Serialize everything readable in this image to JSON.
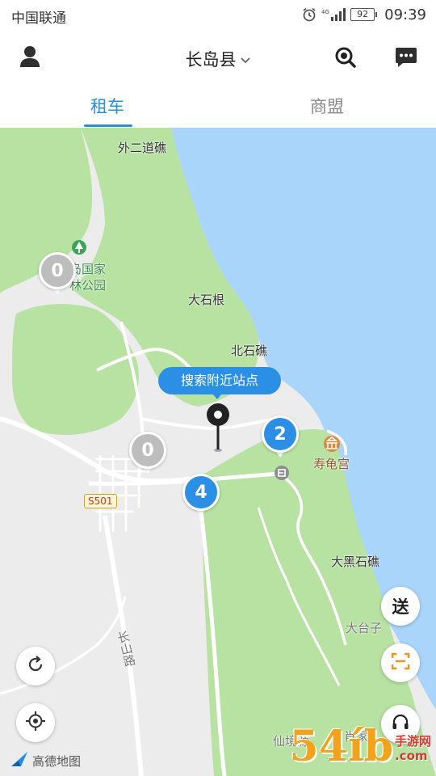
{
  "status_bar": {
    "carrier": "中国联通",
    "battery": "92",
    "time": "09:39"
  },
  "header": {
    "city": "长岛县"
  },
  "tabs": [
    {
      "label": "租车",
      "active": true
    },
    {
      "label": "商盟",
      "active": false
    }
  ],
  "map": {
    "labels": {
      "waierdaojiao": "外二道礁",
      "park_line1": "岛国家",
      "park_line2": "林公园",
      "dashigen": "大石根",
      "beishijiao": "北石礁",
      "shouguigong": "寿龟宫",
      "daheishijiao": "大黑石礁",
      "dataizi": "大台子",
      "changshanlu": "长山路",
      "xianjing": "仙境源",
      "xiaojia": "肖家"
    },
    "road_shield": "S501",
    "search_nearby": "搜索附近站点",
    "clusters": {
      "park": "0",
      "village": "0",
      "east": "2",
      "south": "4"
    },
    "provider_logo": "高德地图",
    "send_button": "送"
  },
  "watermark": {
    "big": "54íb",
    "line1": "手游网",
    "line2": ".com"
  },
  "colors": {
    "accent": "#2b8fe5",
    "sea": "#a9d5fb",
    "green": "#b7e2a2",
    "land": "#ececec"
  }
}
